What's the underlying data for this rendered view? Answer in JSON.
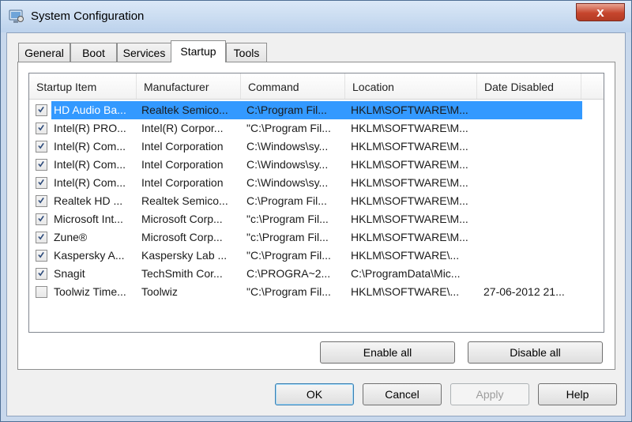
{
  "window": {
    "title": "System Configuration",
    "close_glyph": "x"
  },
  "tabs": [
    {
      "label": "General",
      "active": false
    },
    {
      "label": "Boot",
      "active": false
    },
    {
      "label": "Services",
      "active": false
    },
    {
      "label": "Startup",
      "active": true
    },
    {
      "label": "Tools",
      "active": false
    }
  ],
  "list": {
    "columns": [
      "Startup Item",
      "Manufacturer",
      "Command",
      "Location",
      "Date Disabled"
    ],
    "rows": [
      {
        "checked": true,
        "selected": true,
        "cells": [
          "HD Audio Ba...",
          "Realtek Semico...",
          "C:\\Program Fil...",
          "HKLM\\SOFTWARE\\M...",
          ""
        ]
      },
      {
        "checked": true,
        "selected": false,
        "cells": [
          "Intel(R) PRO...",
          "Intel(R) Corpor...",
          "\"C:\\Program Fil...",
          "HKLM\\SOFTWARE\\M...",
          ""
        ]
      },
      {
        "checked": true,
        "selected": false,
        "cells": [
          "Intel(R) Com...",
          "Intel Corporation",
          "C:\\Windows\\sy...",
          "HKLM\\SOFTWARE\\M...",
          ""
        ]
      },
      {
        "checked": true,
        "selected": false,
        "cells": [
          "Intel(R) Com...",
          "Intel Corporation",
          "C:\\Windows\\sy...",
          "HKLM\\SOFTWARE\\M...",
          ""
        ]
      },
      {
        "checked": true,
        "selected": false,
        "cells": [
          "Intel(R) Com...",
          "Intel Corporation",
          "C:\\Windows\\sy...",
          "HKLM\\SOFTWARE\\M...",
          ""
        ]
      },
      {
        "checked": true,
        "selected": false,
        "cells": [
          "Realtek HD ...",
          "Realtek Semico...",
          "C:\\Program Fil...",
          "HKLM\\SOFTWARE\\M...",
          ""
        ]
      },
      {
        "checked": true,
        "selected": false,
        "cells": [
          "Microsoft Int...",
          "Microsoft Corp...",
          "\"c:\\Program Fil...",
          "HKLM\\SOFTWARE\\M...",
          ""
        ]
      },
      {
        "checked": true,
        "selected": false,
        "cells": [
          "Zune®",
          "Microsoft Corp...",
          "\"c:\\Program Fil...",
          "HKLM\\SOFTWARE\\M...",
          ""
        ]
      },
      {
        "checked": true,
        "selected": false,
        "cells": [
          "Kaspersky A...",
          "Kaspersky Lab ...",
          "\"C:\\Program Fil...",
          "HKLM\\SOFTWARE\\...",
          ""
        ]
      },
      {
        "checked": true,
        "selected": false,
        "cells": [
          "Snagit",
          "TechSmith Cor...",
          "C:\\PROGRA~2...",
          "C:\\ProgramData\\Mic...",
          ""
        ]
      },
      {
        "checked": false,
        "selected": false,
        "cells": [
          "Toolwiz Time...",
          "Toolwiz",
          "\"C:\\Program Fil...",
          "HKLM\\SOFTWARE\\...",
          "27-06-2012 21..."
        ]
      }
    ]
  },
  "buttons": {
    "enable_all": "Enable all",
    "disable_all": "Disable all",
    "ok": "OK",
    "cancel": "Cancel",
    "apply": "Apply",
    "help": "Help"
  },
  "colors": {
    "selection": "#3399ff",
    "title_bar": "#bcd2ec",
    "close_button": "#c6452d"
  }
}
